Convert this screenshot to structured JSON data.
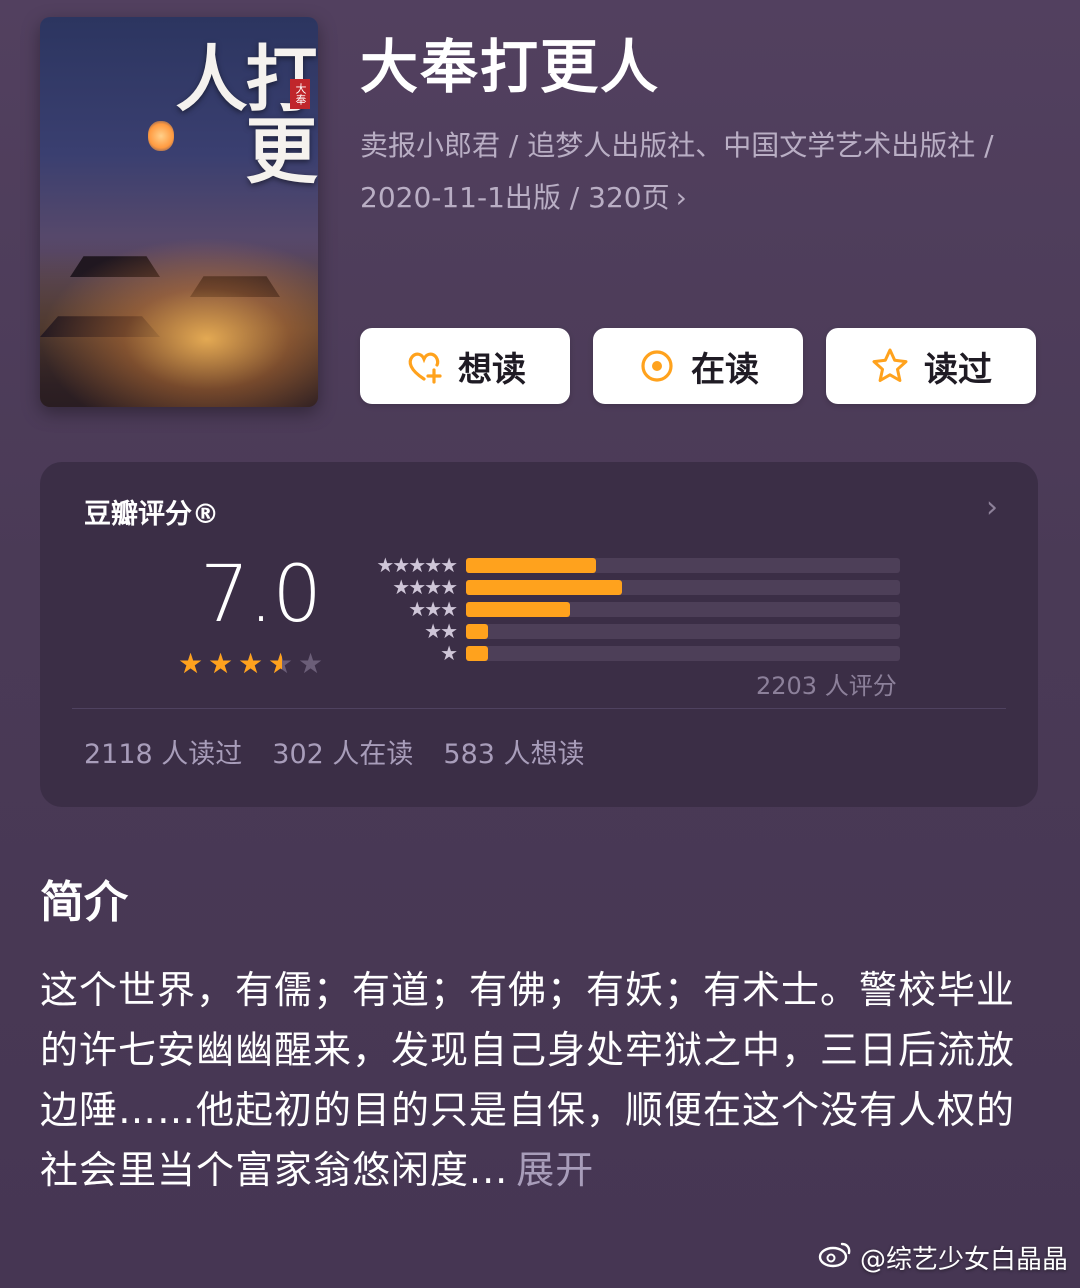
{
  "book": {
    "title": "大奉打更人",
    "meta": "卖报小郎君 / 追梦人出版社、中国文学艺术出版社 / 2020-11-1出版 / 320页",
    "cover_title_art": "打更人",
    "cover_seal": "大奉"
  },
  "actions": {
    "want_label": "想读",
    "reading_label": "在读",
    "read_label": "读过"
  },
  "rating": {
    "label": "豆瓣评分®",
    "score": "7.0",
    "stars_filled": 3.5,
    "stars_total": 5,
    "distribution": [
      {
        "stars": "★★★★★",
        "fraction": 0.3
      },
      {
        "stars": "★★★★",
        "fraction": 0.36
      },
      {
        "stars": "★★★",
        "fraction": 0.24
      },
      {
        "stars": "★★",
        "fraction": 0.05
      },
      {
        "stars": "★",
        "fraction": 0.05
      }
    ],
    "total_ratings": "2203 人评分",
    "counts": {
      "read": "2118 人读过",
      "reading": "302 人在读",
      "want": "583 人想读"
    }
  },
  "intro": {
    "title": "简介",
    "text": "这个世界，有儒；有道；有佛；有妖；有术士。警校毕业的许七安幽幽醒来，发现自己身处牢狱之中，三日后流放边陲……他起初的目的只是自保，顺便在这个没有人权的社会里当个富家翁悠闲度...",
    "expand_label": "展开"
  },
  "watermark": "@综艺少女白晶晶",
  "colors": {
    "accent": "#ffa21d",
    "card": "#3b2e46",
    "background": "#4a3a56"
  }
}
